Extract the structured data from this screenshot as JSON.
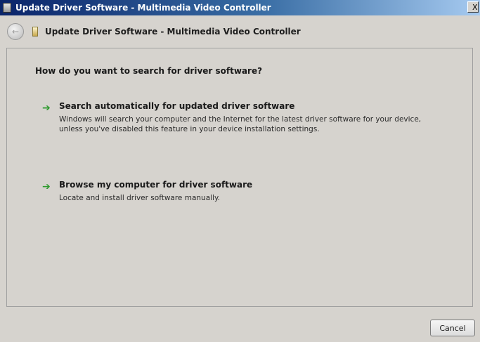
{
  "window": {
    "title": "Update Driver Software - Multimedia Video Controller",
    "close_label": "X"
  },
  "header": {
    "title": "Update Driver Software - Multimedia Video Controller",
    "back_glyph": "←"
  },
  "content": {
    "question": "How do you want to search for driver software?",
    "options": [
      {
        "title": "Search automatically for updated driver software",
        "description": "Windows will search your computer and the Internet for the latest driver software for your device, unless you've disabled this feature in your device installation settings.",
        "icon": "green-arrow-icon"
      },
      {
        "title": "Browse my computer for driver software",
        "description": "Locate and install driver software manually.",
        "icon": "green-arrow-icon"
      }
    ]
  },
  "footer": {
    "cancel_label": "Cancel"
  },
  "colors": {
    "arrow": "#2e9a2e",
    "titlebar_start": "#0a246a",
    "titlebar_end": "#a6caf0"
  }
}
